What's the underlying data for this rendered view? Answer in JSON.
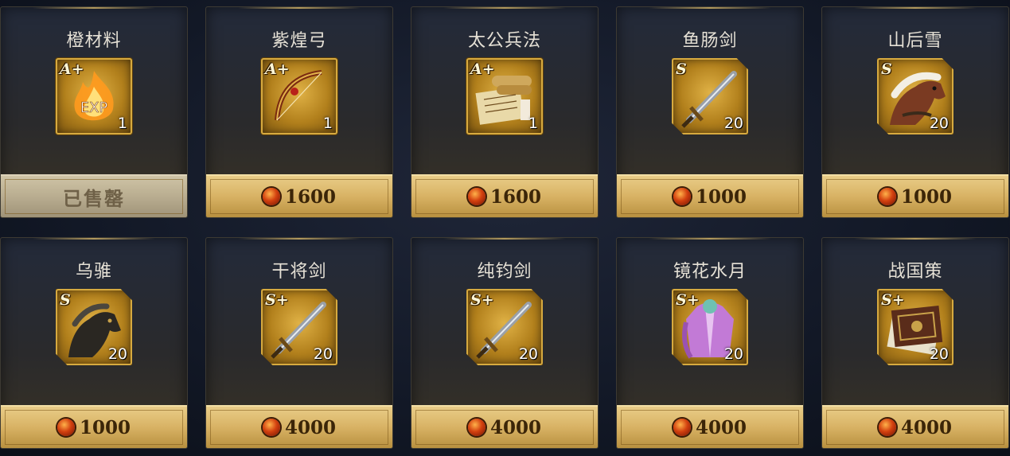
{
  "shop": {
    "items": [
      {
        "name": "橙材料",
        "grade": "A+",
        "qty": "1",
        "price": "",
        "sold": true,
        "sold_label": "已售罄",
        "art": "exp-fire-icon"
      },
      {
        "name": "紫煌弓",
        "grade": "A+",
        "qty": "1",
        "price": "1600",
        "sold": false,
        "art": "bow-icon"
      },
      {
        "name": "太公兵法",
        "grade": "A+",
        "qty": "1",
        "price": "1600",
        "sold": false,
        "art": "scroll-icon"
      },
      {
        "name": "鱼肠剑",
        "grade": "S",
        "qty": "20",
        "price": "1000",
        "sold": false,
        "art": "sword-icon"
      },
      {
        "name": "山后雪",
        "grade": "S",
        "qty": "20",
        "price": "1000",
        "sold": false,
        "art": "horse-icon"
      },
      {
        "name": "乌骓",
        "grade": "S",
        "qty": "20",
        "price": "1000",
        "sold": false,
        "art": "dark-horse-icon"
      },
      {
        "name": "干将剑",
        "grade": "S+",
        "qty": "20",
        "price": "4000",
        "sold": false,
        "art": "sword-icon"
      },
      {
        "name": "纯钧剑",
        "grade": "S+",
        "qty": "20",
        "price": "4000",
        "sold": false,
        "art": "sword-icon"
      },
      {
        "name": "镜花水月",
        "grade": "S+",
        "qty": "20",
        "price": "4000",
        "sold": false,
        "art": "robe-icon"
      },
      {
        "name": "战国策",
        "grade": "S+",
        "qty": "20",
        "price": "4000",
        "sold": false,
        "art": "book-icon"
      }
    ]
  },
  "colors": {
    "gold": "#d7aa3f",
    "coin": "#d3400f",
    "sold_bar": "#b9ad90"
  }
}
